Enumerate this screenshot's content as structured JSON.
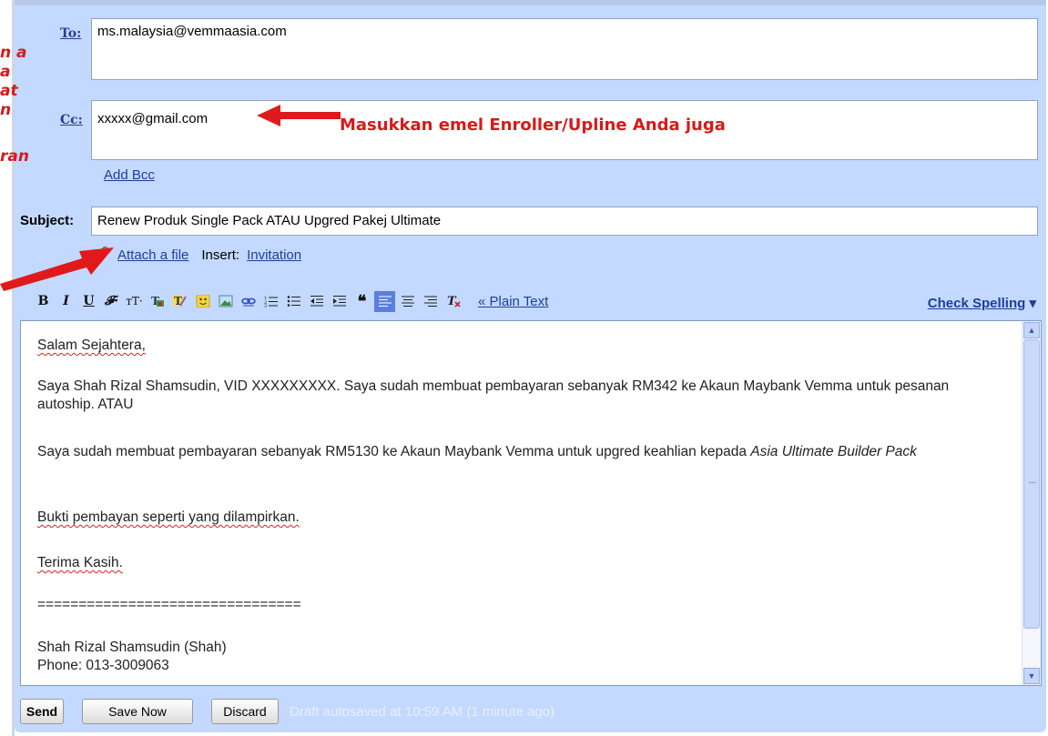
{
  "annotations": {
    "cc_note": "Masukkan emel Enroller/Upline Anda juga",
    "left_fragments": "n a\na\nat\nn",
    "left_fragment_2": "ran"
  },
  "compose": {
    "to_label": "To:",
    "to_value": "ms.malaysia@vemmaasia.com",
    "cc_label": "Cc:",
    "cc_value": "xxxxx@gmail.com",
    "add_bcc": "Add Bcc",
    "subject_label": "Subject:",
    "subject_value": "Renew Produk Single Pack ATAU Upgred Pakej Ultimate",
    "attach_label": "Attach a file",
    "insert_label": "Insert:",
    "insert_link": "Invitation"
  },
  "toolbar": {
    "buttons": [
      "B",
      "I",
      "U",
      "F",
      "tT",
      "text-color",
      "highlight",
      "emoticon",
      "image",
      "link",
      "numbered-list",
      "bulleted-list",
      "outdent",
      "indent",
      "quote",
      "align-left",
      "align-center",
      "align-right",
      "remove-format"
    ],
    "plain_text": "« Plain Text",
    "check_spelling": "Check Spelling",
    "dropdown_arrow": "▾"
  },
  "body": {
    "greeting": "Salam Sejahtera,",
    "p1": "Saya Shah Rizal Shamsudin, VID XXXXXXXXX. Saya sudah membuat pembayaran sebanyak RM342 ke Akaun Maybank Vemma untuk pesanan autoship. ATAU",
    "p2_a": "Saya sudah membuat pembayaran sebanyak RM5130 ke Akaun Maybank Vemma untuk upgred keahlian kepada ",
    "p2_b": "Asia Ultimate Builder Pack",
    "p3": "Bukti pembayan seperti yang dilampirkan.",
    "p4": "Terima Kasih.",
    "divider": "================================",
    "sig_name": "Shah Rizal Shamsudin (Shah)",
    "sig_phone": "Phone: 013-3009063"
  },
  "footer": {
    "send": "Send",
    "save_now": "Save Now",
    "discard": "Discard",
    "status": "Draft autosaved at 10:59 AM (1 minute ago)"
  },
  "colors": {
    "panel": "#c3d9ff",
    "annotation_red": "#d61a1a",
    "link_blue": "#1f3f9c"
  }
}
